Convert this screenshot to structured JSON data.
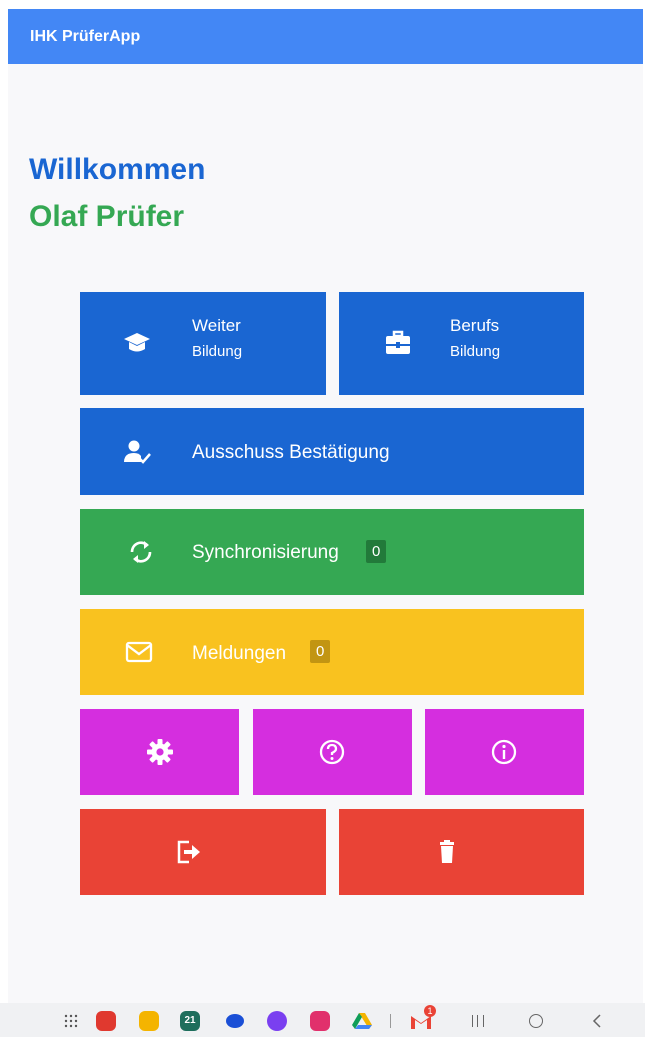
{
  "appbar": {
    "title": "IHK PrüferApp"
  },
  "welcome": {
    "greeting": "Willkommen",
    "user": "Olaf Prüfer"
  },
  "menu": {
    "weiter": {
      "title": "Weiter",
      "subtitle": "Bildung",
      "icon": "graduation-cap-icon"
    },
    "berufs": {
      "title": "Berufs",
      "subtitle": "Bildung",
      "icon": "briefcase-icon"
    },
    "ausschuss": {
      "label": "Ausschuss Bestätigung",
      "icon": "user-check-icon"
    },
    "sync": {
      "label": "Synchronisierung",
      "count": "0",
      "icon": "sync-icon"
    },
    "meldungen": {
      "label": "Meldungen",
      "count": "0",
      "icon": "envelope-icon"
    },
    "settings": {
      "icon": "gear-icon"
    },
    "help": {
      "icon": "question-circle-icon"
    },
    "info": {
      "icon": "info-circle-icon"
    },
    "logout": {
      "icon": "logout-icon"
    },
    "delete": {
      "icon": "trash-icon"
    }
  },
  "colors": {
    "appbar": "#4387f5",
    "blue": "#1a66d2",
    "green": "#35a853",
    "yellow": "#f9c21f",
    "magenta": "#d52edf",
    "red": "#e94336"
  },
  "navbar": {
    "gmail_badge": "1",
    "calendar_day": "21"
  }
}
